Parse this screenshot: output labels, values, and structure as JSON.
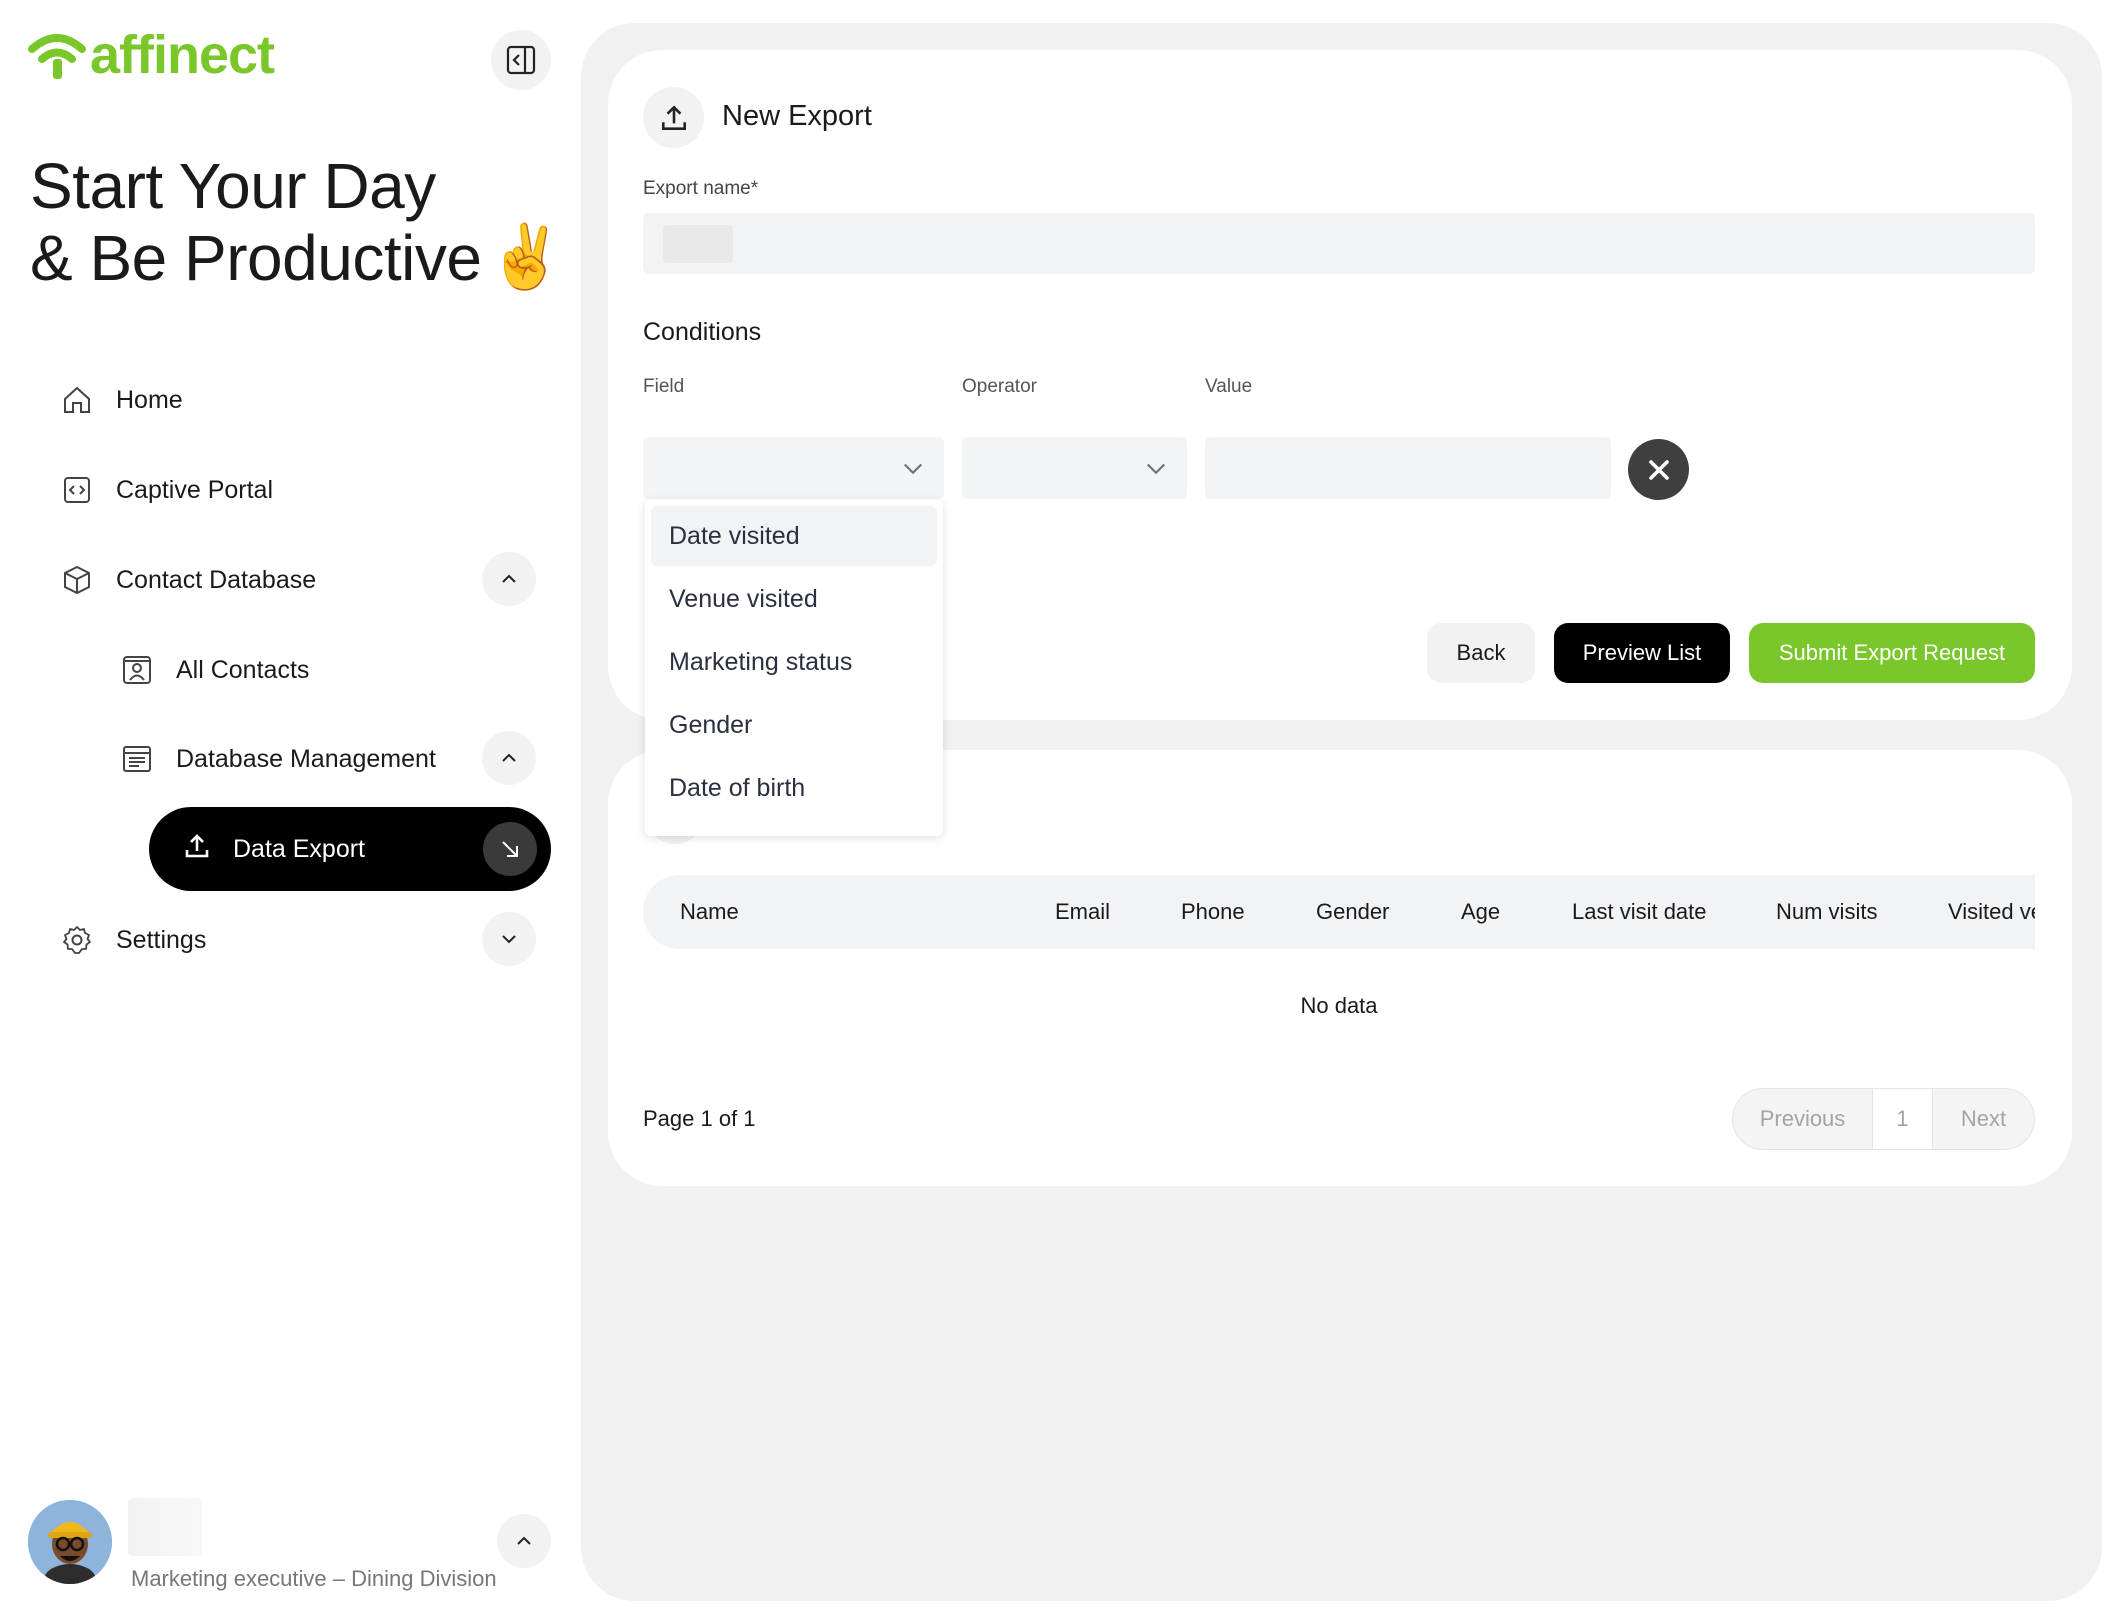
{
  "brand": {
    "name": "affinect",
    "color": "#7ac72b"
  },
  "sidebar": {
    "headline_line1": "Start Your Day",
    "headline_line2": "& Be Productive",
    "headline_emoji": "✌️",
    "items": [
      {
        "label": "Home",
        "icon": "home-icon"
      },
      {
        "label": "Captive Portal",
        "icon": "code-window-icon"
      },
      {
        "label": "Contact Database",
        "icon": "cube-icon",
        "expanded": true
      },
      {
        "label": "All Contacts",
        "icon": "contact-card-icon"
      },
      {
        "label": "Database Management",
        "icon": "list-window-icon",
        "expanded": true
      },
      {
        "label": "Data Export",
        "icon": "upload-icon",
        "active": true
      },
      {
        "label": "Settings",
        "icon": "gear-icon",
        "expanded": false
      }
    ],
    "user": {
      "role": "Marketing executive – Dining Division"
    }
  },
  "export_form": {
    "title": "New Export",
    "name_label": "Export name*",
    "name_value": "",
    "conditions_title": "Conditions",
    "columns": {
      "field": "Field",
      "operator": "Operator",
      "value": "Value"
    },
    "field_options": [
      "Date visited",
      "Venue visited",
      "Marketing status",
      "Gender",
      "Date of birth"
    ],
    "buttons": {
      "back": "Back",
      "preview": "Preview List",
      "submit": "Submit Export Request"
    }
  },
  "results": {
    "columns": [
      "Name",
      "Email",
      "Phone",
      "Gender",
      "Age",
      "Last visit date",
      "Num visits",
      "Visited ve"
    ],
    "empty_text": "No data",
    "page_info": "Page 1 of 1",
    "pager": {
      "previous": "Previous",
      "current": "1",
      "next": "Next"
    }
  }
}
